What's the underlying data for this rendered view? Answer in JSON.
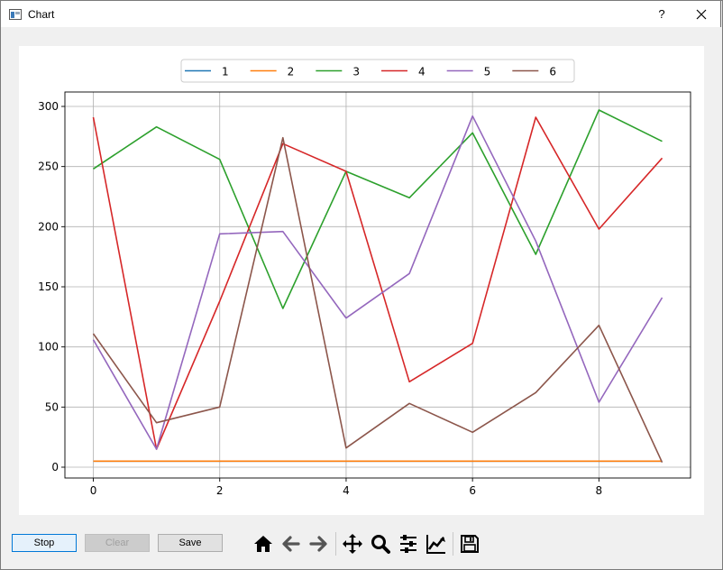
{
  "window": {
    "title": "Chart",
    "help_label": "?",
    "close_icon": "close-icon"
  },
  "buttons": {
    "stop": "Stop",
    "clear": "Clear",
    "save": "Save"
  },
  "toolbar": [
    "home-icon",
    "back-icon",
    "forward-icon",
    "pan-icon",
    "zoom-icon",
    "configure-subplots-icon",
    "edit-axis-icon",
    "save-figure-icon"
  ],
  "chart_data": {
    "type": "line",
    "title": "",
    "xlabel": "",
    "ylabel": "",
    "xlim": [
      -0.45,
      9.45
    ],
    "ylim": [
      -9,
      312
    ],
    "xticks": [
      0,
      2,
      4,
      6,
      8
    ],
    "yticks": [
      0,
      50,
      100,
      150,
      200,
      250,
      300
    ],
    "grid": true,
    "legend_position": "top-center",
    "x": [
      0,
      1,
      2,
      3,
      4,
      5,
      6,
      7,
      8,
      9
    ],
    "series": [
      {
        "name": "1",
        "color": "#1f77b4",
        "values": [
          5,
          5,
          5,
          5,
          5,
          5,
          5,
          5,
          5,
          5
        ]
      },
      {
        "name": "2",
        "color": "#ff7f0e",
        "values": [
          5,
          5,
          5,
          5,
          5,
          5,
          5,
          5,
          5,
          5
        ]
      },
      {
        "name": "3",
        "color": "#2ca02c",
        "values": [
          248,
          283,
          256,
          132,
          246,
          224,
          278,
          177,
          297,
          271
        ]
      },
      {
        "name": "4",
        "color": "#d62728",
        "values": [
          291,
          15,
          138,
          269,
          246,
          71,
          103,
          291,
          198,
          257
        ]
      },
      {
        "name": "5",
        "color": "#9467bd",
        "values": [
          106,
          15,
          194,
          196,
          124,
          161,
          292,
          188,
          54,
          141
        ]
      },
      {
        "name": "6",
        "color": "#8c564b",
        "values": [
          111,
          37,
          50,
          274,
          16,
          53,
          29,
          62,
          118,
          4
        ]
      }
    ]
  }
}
